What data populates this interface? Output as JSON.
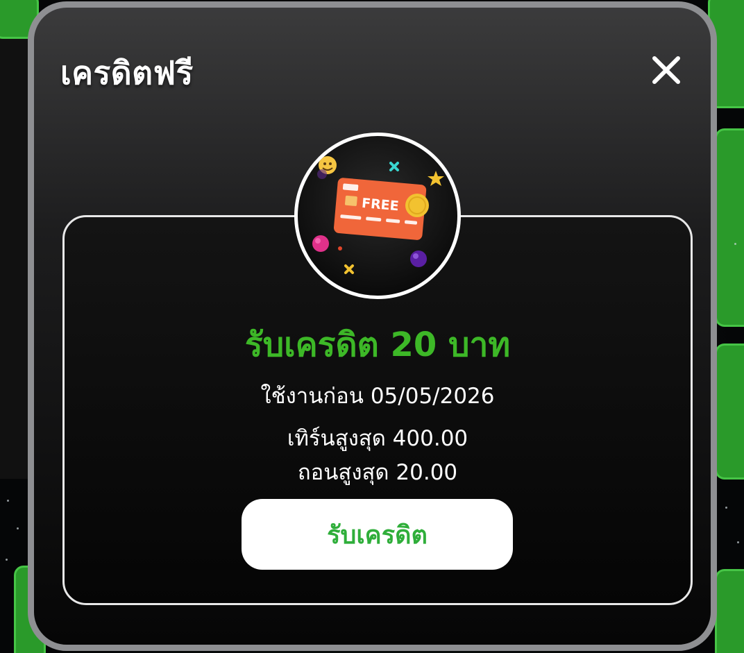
{
  "modal": {
    "title": "เครดิตฟรี",
    "close_icon": "close-icon"
  },
  "promo": {
    "icon": "free-credit-card-icon",
    "card_text": "FREE",
    "headline": "รับเครดิต 20 บาท",
    "expiry": "ใช้งานก่อน 05/05/2026",
    "max_turnover": "เทิร์นสูงสุด 400.00",
    "max_withdraw": "ถอนสูงสุด 20.00",
    "claim_label": "รับเครดิต"
  },
  "colors": {
    "accent_green": "#3db827",
    "button_text_green": "#2fae3a",
    "card_orange": "#f0663a",
    "modal_border": "#8e8f92"
  }
}
